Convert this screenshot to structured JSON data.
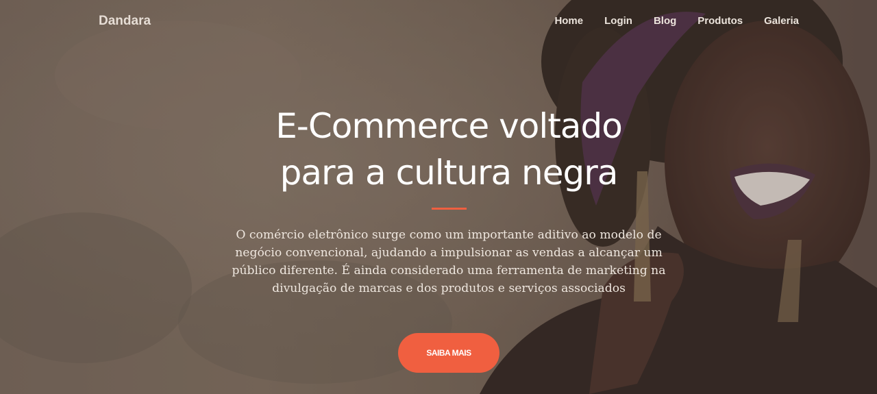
{
  "nav": {
    "brand": "Dandara",
    "links": [
      "Home",
      "Login",
      "Blog",
      "Produtos",
      "Galeria"
    ]
  },
  "hero": {
    "headline_line1": "E-Commerce voltado",
    "headline_line2": "para a cultura negra",
    "lead": "O comércio eletrônico surge como um importante aditivo ao modelo de negócio convencional, ajudando a impulsionar as vendas a alcançar um público diferente. É ainda considerado uma ferramenta de marketing na divulgação de marcas e dos produtos e serviços associados",
    "cta_label": "SAIBA MAIS"
  },
  "colors": {
    "accent": "#f05f40",
    "text_light": "#ffffff"
  }
}
